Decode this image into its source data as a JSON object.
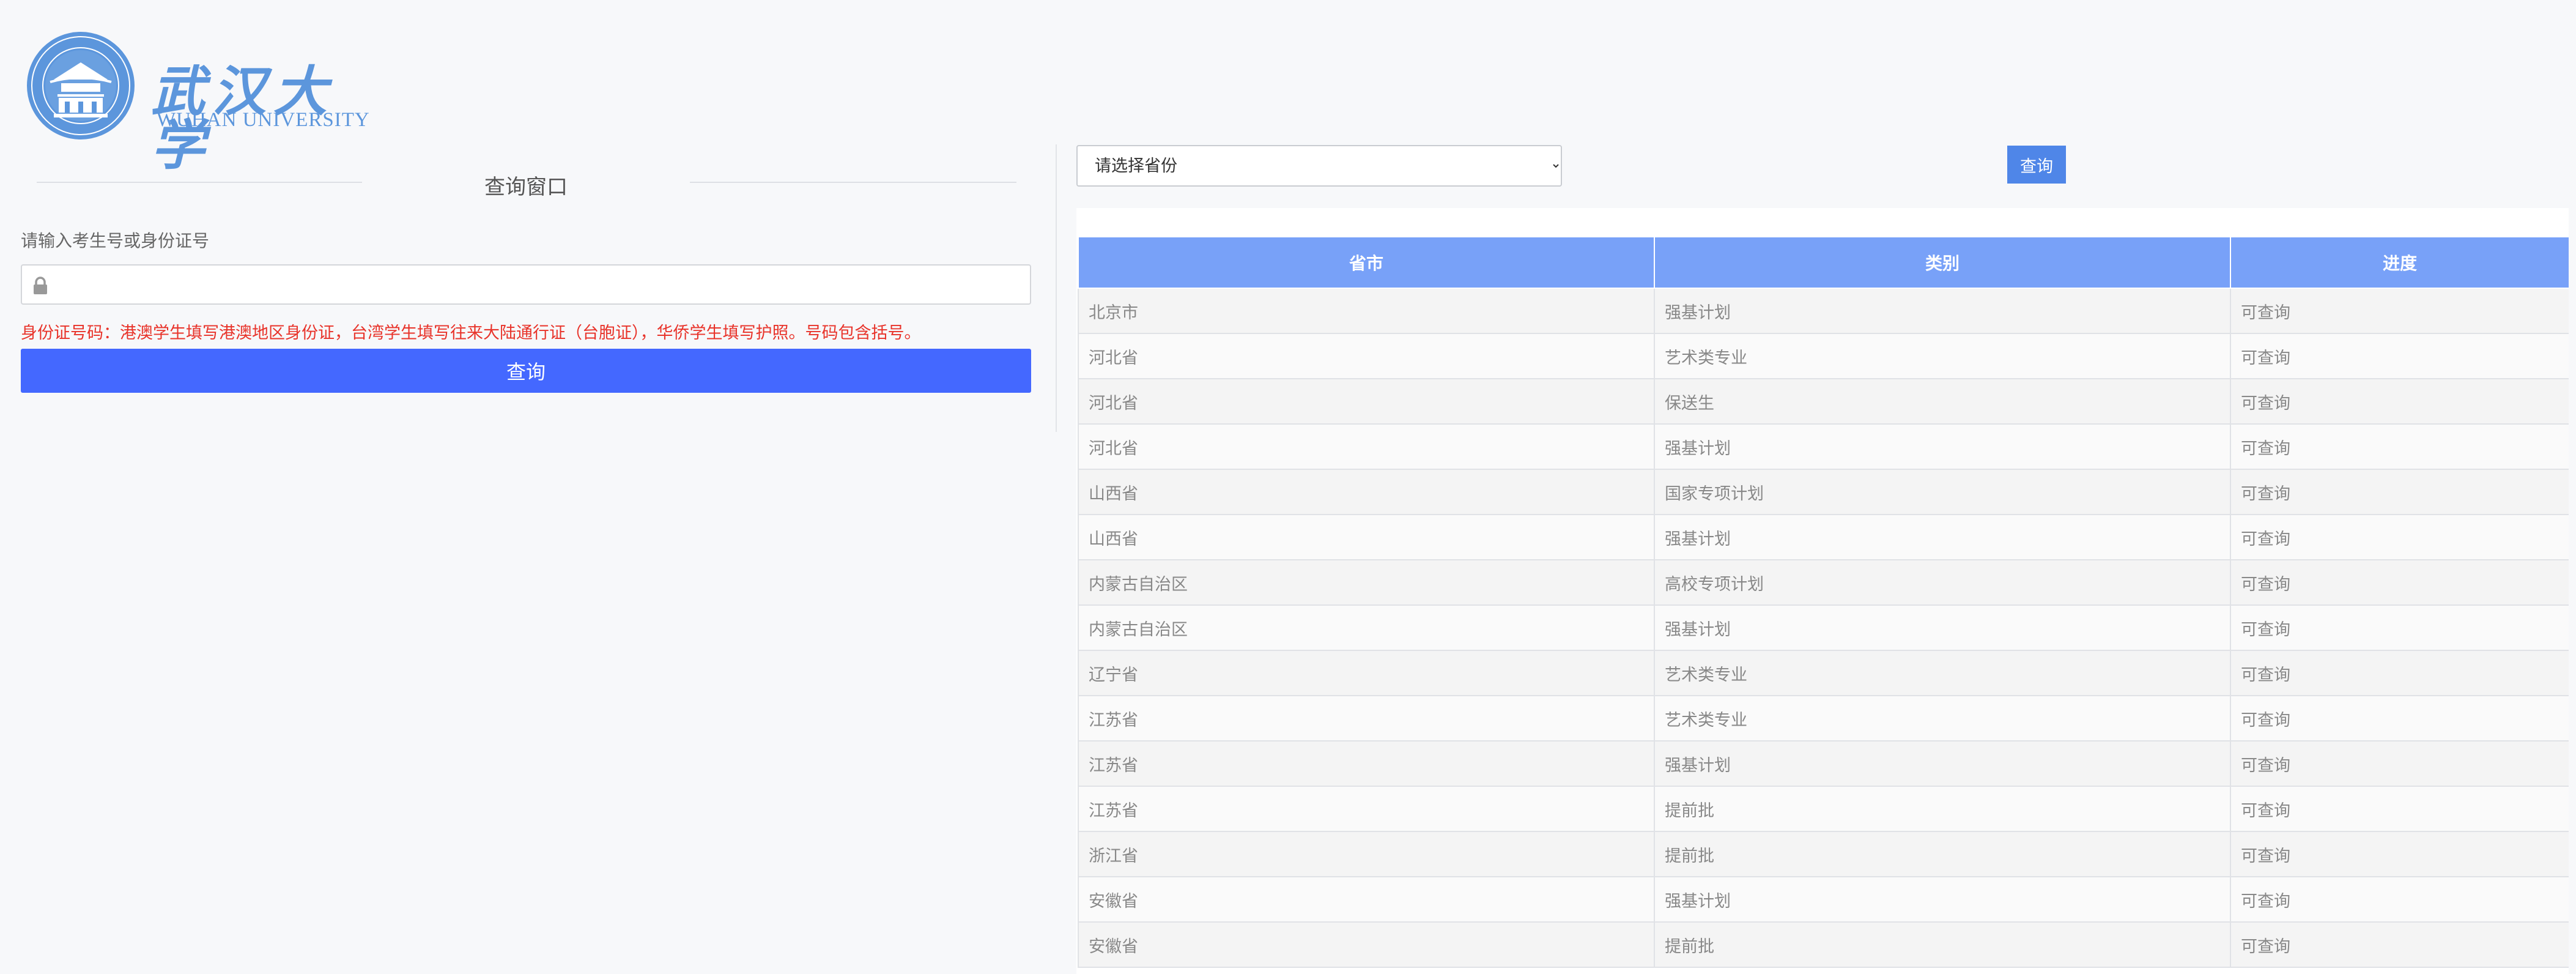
{
  "header": {
    "logo_cn": "武汉大学",
    "logo_en": "WUHAN UNIVERSITY",
    "brand_color": "#5c96dc"
  },
  "left_panel": {
    "title": "查询窗口",
    "field_label": "请输入考生号或身份证号",
    "input_value": "",
    "input_icon": "lock-icon",
    "hint": "身份证号码：港澳学生填写港澳地区身份证，台湾学生填写往来大陆通行证（台胞证），华侨学生填写护照。号码包含括号。",
    "query_button": "查询",
    "accent_color": "#4468ff",
    "hint_color": "#e8332a"
  },
  "right_panel": {
    "province_select": {
      "selected": "请选择省份"
    },
    "query_button": "查询",
    "table": {
      "headers": [
        "省市",
        "类别",
        "进度"
      ],
      "header_color": "#78a1f8",
      "rows": [
        [
          "北京市",
          "强基计划",
          "可查询"
        ],
        [
          "河北省",
          "艺术类专业",
          "可查询"
        ],
        [
          "河北省",
          "保送生",
          "可查询"
        ],
        [
          "河北省",
          "强基计划",
          "可查询"
        ],
        [
          "山西省",
          "国家专项计划",
          "可查询"
        ],
        [
          "山西省",
          "强基计划",
          "可查询"
        ],
        [
          "内蒙古自治区",
          "高校专项计划",
          "可查询"
        ],
        [
          "内蒙古自治区",
          "强基计划",
          "可查询"
        ],
        [
          "辽宁省",
          "艺术类专业",
          "可查询"
        ],
        [
          "江苏省",
          "艺术类专业",
          "可查询"
        ],
        [
          "江苏省",
          "强基计划",
          "可查询"
        ],
        [
          "江苏省",
          "提前批",
          "可查询"
        ],
        [
          "浙江省",
          "提前批",
          "可查询"
        ],
        [
          "安徽省",
          "强基计划",
          "可查询"
        ],
        [
          "安徽省",
          "提前批",
          "可查询"
        ]
      ]
    }
  }
}
